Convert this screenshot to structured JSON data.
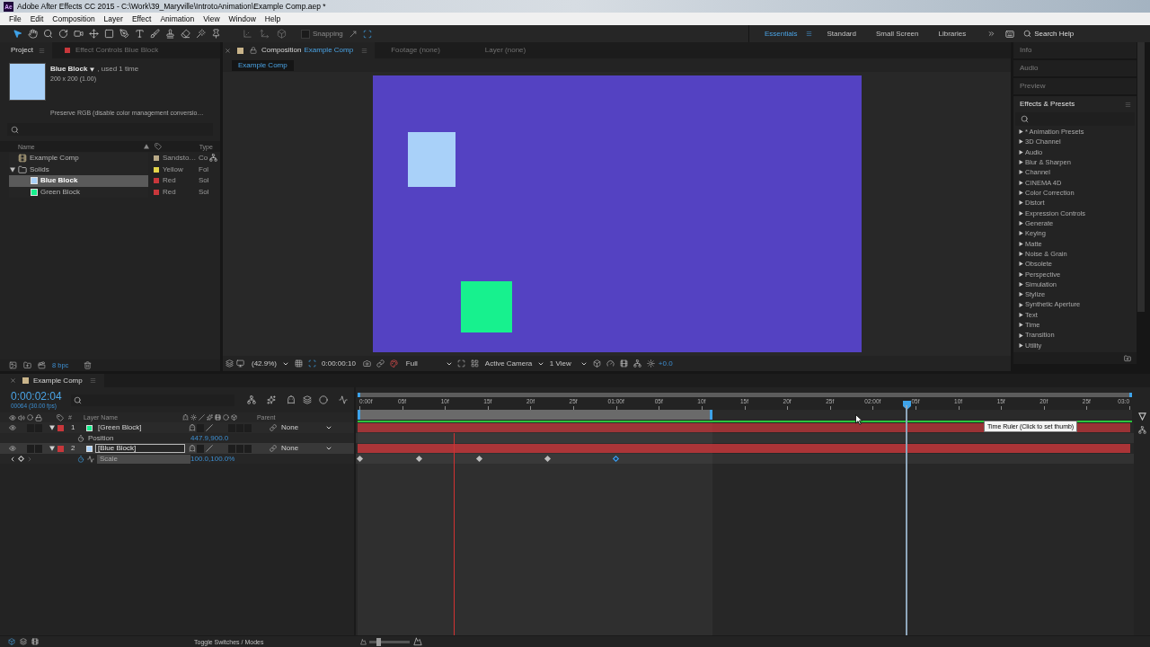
{
  "window": {
    "app_icon": "Ae",
    "title": "Adobe After Effects CC 2015 - C:\\Work\\39_Maryville\\IntrotoAnimation\\Example Comp.aep *"
  },
  "menu": [
    "File",
    "Edit",
    "Composition",
    "Layer",
    "Effect",
    "Animation",
    "View",
    "Window",
    "Help"
  ],
  "toolbar": {
    "tools": [
      {
        "kind": "selection",
        "selected": true
      },
      {
        "kind": "hand",
        "selected": false
      },
      {
        "kind": "zoom",
        "selected": false
      },
      {
        "kind": "rotate",
        "selected": false
      },
      {
        "kind": "camera",
        "selected": false
      },
      {
        "kind": "pan",
        "selected": false
      },
      {
        "kind": "rectangle",
        "selected": false
      },
      {
        "kind": "pen",
        "selected": false
      },
      {
        "kind": "type",
        "selected": false
      },
      {
        "kind": "brush",
        "selected": false
      },
      {
        "kind": "stamp",
        "selected": false
      },
      {
        "kind": "eraser",
        "selected": false
      },
      {
        "kind": "roto",
        "selected": false
      },
      {
        "kind": "pin",
        "selected": false
      }
    ],
    "axis_modes": [
      {
        "kind": "local",
        "disabled": true
      },
      {
        "kind": "world",
        "disabled": true
      },
      {
        "kind": "view",
        "disabled": true
      }
    ],
    "snapping": {
      "label": "Snapping",
      "checked": false
    },
    "workspaces": [
      {
        "label": "Essentials",
        "selected": true
      },
      {
        "label": "Standard",
        "selected": false
      },
      {
        "label": "Small Screen",
        "selected": false
      },
      {
        "label": "Libraries",
        "selected": false
      }
    ],
    "search": {
      "placeholder": "Search Help"
    }
  },
  "project": {
    "tabs": [
      {
        "label": "Project",
        "selected": true
      },
      {
        "label": "Effect Controls Blue Block",
        "selected": false,
        "color": "#c8373b"
      }
    ],
    "preview": {
      "name": "Blue Block",
      "usage": ", used 1 time",
      "size": "200 x 200 (1.00)",
      "note": "Preserve RGB (disable color management conversio…"
    },
    "columns": {
      "name": "Name",
      "type": "Type"
    },
    "items": [
      {
        "kind": "comp",
        "name": "Example Comp",
        "label": "Sandsto…",
        "color": "#b9aa88",
        "type": "Co",
        "selected": false
      },
      {
        "kind": "folder",
        "name": "Solids",
        "label": "Yellow",
        "color": "#e3d54a",
        "type": "Fol",
        "selected": false,
        "expanded": true,
        "children": [
          {
            "kind": "solid",
            "name": "Blue Block",
            "label": "Red",
            "color": "#c8373b",
            "type": "Sol",
            "selected": true,
            "swatch": {
              "color": "#a9d1f9"
            }
          },
          {
            "kind": "solid",
            "name": "Green Block",
            "label": "Red",
            "color": "#c8373b",
            "type": "Sol",
            "selected": false,
            "swatch": {
              "color": "#17f18e"
            }
          }
        ]
      }
    ],
    "depth": "8 bpc"
  },
  "composition": {
    "tabs": [
      {
        "label": "Composition",
        "name": "Example Comp",
        "selected": true,
        "color": "#c9b48a"
      },
      {
        "label": "Footage (none)",
        "selected": false
      },
      {
        "label": "Layer (none)",
        "selected": false
      }
    ],
    "breadcrumb": "Example Comp",
    "viewer_bar": {
      "magnification": "(42.9%)",
      "time": "0:00:00:10",
      "resolution": "Full",
      "camera": "Active Camera",
      "views": "1 View",
      "exposure": "+0.0"
    }
  },
  "right_panels": {
    "collapsed": [
      "Info",
      "Audio",
      "Preview"
    ],
    "effects": {
      "title": "Effects & Presets",
      "items": [
        {
          "label": "* Animation Presets",
          "expanded": false
        },
        {
          "label": "3D Channel",
          "expanded": false
        },
        {
          "label": "Audio",
          "expanded": false
        },
        {
          "label": "Blur & Sharpen",
          "expanded": false
        },
        {
          "label": "Channel",
          "expanded": false
        },
        {
          "label": "CINEMA 4D",
          "expanded": false
        },
        {
          "label": "Color Correction",
          "expanded": false
        },
        {
          "label": "Distort",
          "expanded": false
        },
        {
          "label": "Expression Controls",
          "expanded": false
        },
        {
          "label": "Generate",
          "expanded": false
        },
        {
          "label": "Keying",
          "expanded": false
        },
        {
          "label": "Matte",
          "expanded": false
        },
        {
          "label": "Noise & Grain",
          "expanded": false
        },
        {
          "label": "Obsolete",
          "expanded": false
        },
        {
          "label": "Perspective",
          "expanded": false
        },
        {
          "label": "Simulation",
          "expanded": false
        },
        {
          "label": "Stylize",
          "expanded": false
        },
        {
          "label": "Synthetic Aperture",
          "expanded": false
        },
        {
          "label": "Text",
          "expanded": false
        },
        {
          "label": "Time",
          "expanded": false
        },
        {
          "label": "Transition",
          "expanded": false
        },
        {
          "label": "Utility",
          "expanded": false
        }
      ]
    }
  },
  "timeline": {
    "tab": {
      "label": "Example Comp",
      "color": "#c9b48a"
    },
    "timecode": "0:00:02:04",
    "frames": "00064 (30.00 fps)",
    "headers": {
      "number": "#",
      "layer_name": "Layer Name",
      "parent": "Parent"
    },
    "layers": [
      {
        "number": "1",
        "name": "[Green Block]",
        "color": "#c8373b",
        "swatch": {
          "color": "#17f18e"
        },
        "expanded": true,
        "selected": false,
        "parent": "None",
        "properties": [
          {
            "name": "Position",
            "value": "447.9,900.0",
            "animated": false,
            "selected": false
          }
        ]
      },
      {
        "number": "2",
        "name": "[Blue Block]",
        "color": "#c8373b",
        "swatch": {
          "color": "#a9d1f9"
        },
        "expanded": true,
        "selected": true,
        "parent": "None",
        "properties": [
          {
            "name": "Scale",
            "value": "100.0,100.0%",
            "animated": true,
            "selected": true,
            "keyframes": [
              {
                "level": 0,
                "selected": false
              },
              {
                "level": 0.078,
                "selected": false
              },
              {
                "level": 0.156,
                "selected": false
              },
              {
                "level": 0.244,
                "selected": false
              },
              {
                "level": 0.333,
                "selected": true
              }
            ]
          }
        ]
      }
    ],
    "ruler": [
      "0:00f",
      "05f",
      "10f",
      "15f",
      "20f",
      "25f",
      "01:00f",
      "05f",
      "10f",
      "15f",
      "20f",
      "25f",
      "02:00f",
      "05f",
      "10f",
      "15f",
      "20f",
      "25f",
      "03:0"
    ],
    "work_area": {
      "level": 0.458
    },
    "playhead": {
      "level": 0.711
    },
    "marker": {
      "level": 0.122
    },
    "tooltip": "Time Ruler (Click to set thumb)",
    "footer": "Toggle Switches / Modes",
    "zoom_slider": {
      "level": 0.22
    }
  }
}
